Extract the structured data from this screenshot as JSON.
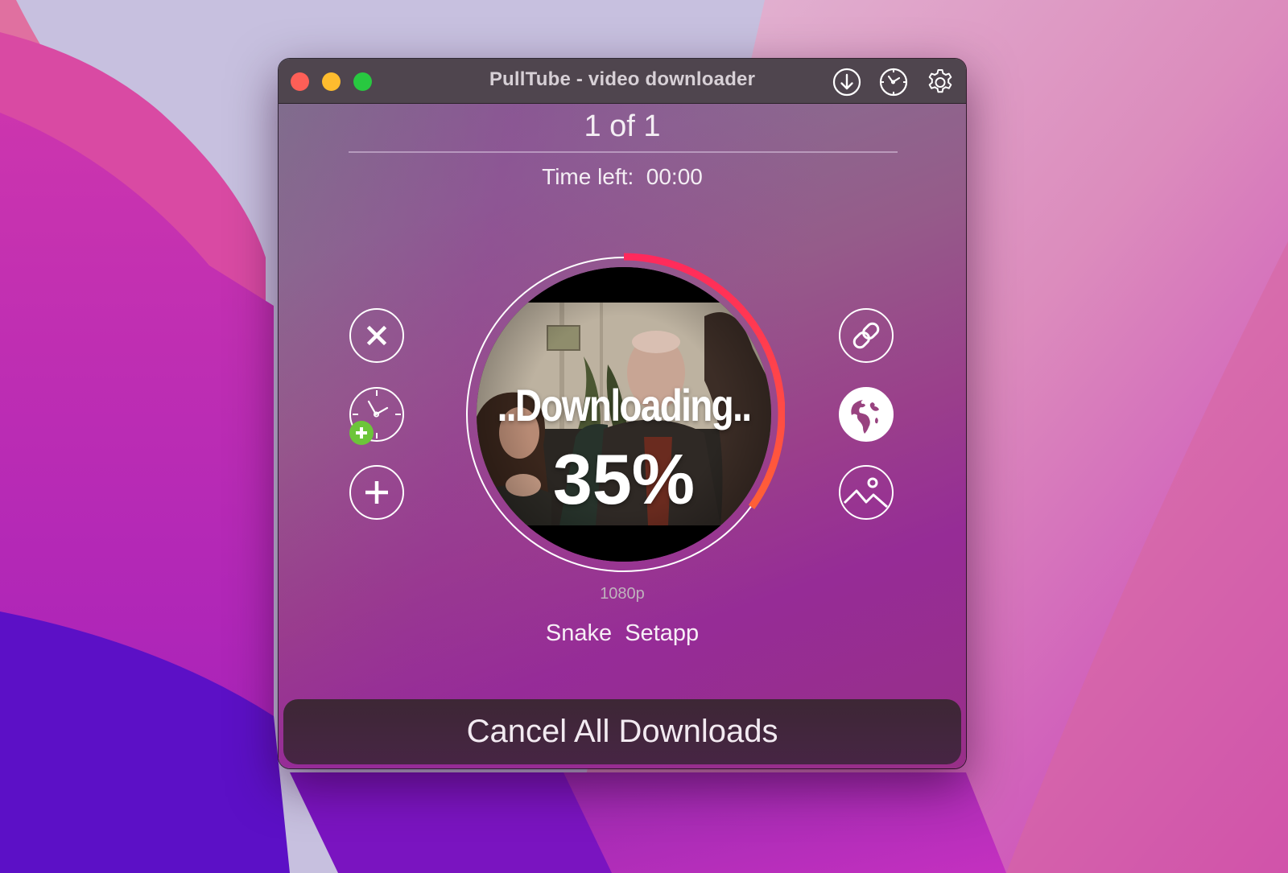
{
  "window": {
    "title": "PullTube - video downloader",
    "traffic_lights": [
      "close",
      "minimize",
      "zoom"
    ],
    "toolbar_icons": [
      "download-icon",
      "history-clock-icon",
      "settings-gear-icon"
    ]
  },
  "queue": {
    "counter": "1 of 1",
    "time_left_label": "Time left:",
    "time_left_value": "00:00"
  },
  "left_actions": [
    {
      "name": "cancel-download",
      "icon": "close-icon"
    },
    {
      "name": "schedule-download",
      "icon": "clock-plus-icon"
    },
    {
      "name": "add-download",
      "icon": "plus-icon"
    }
  ],
  "right_actions": [
    {
      "name": "copy-link",
      "icon": "link-icon"
    },
    {
      "name": "open-in-browser",
      "icon": "globe-icon"
    },
    {
      "name": "show-thumbnail",
      "icon": "image-icon"
    }
  ],
  "download": {
    "status": "..Downloading..",
    "percent_label": "35%",
    "progress": 0.35,
    "quality": "1080p",
    "title_part1": "Snake",
    "title_part2": "Setapp"
  },
  "colors": {
    "progress_start": "#ff2a5c",
    "progress_end": "#ff6036",
    "badge_green": "#6cc53a",
    "titlebar": "#4f454e"
  },
  "footer": {
    "cancel_all_label": "Cancel All Downloads"
  }
}
